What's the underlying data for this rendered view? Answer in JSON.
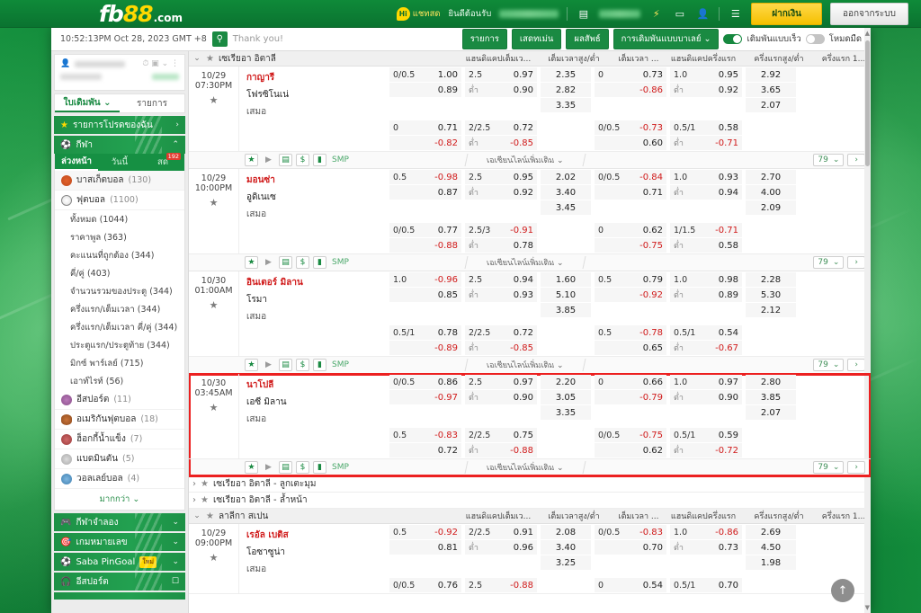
{
  "brand": {
    "fb": "fb",
    "n88": "88",
    "com": ".com"
  },
  "topbar": {
    "hi_badge": "Hi",
    "live_chat": "แชทสด",
    "welcome": "ยินดีต้อนรับ",
    "icons": [
      "wallet-icon",
      "lightning-icon",
      "cash-icon",
      "user-icon",
      "list-icon"
    ],
    "deposit_label": "ฝากเงิน",
    "logout_label": "ออกจากระบบ"
  },
  "toolbar": {
    "clock": "10:52:13PM Oct 28, 2023 GMT +8",
    "search_icon": "search-icon",
    "thank_you": "Thank you!",
    "btn_list": "รายการ",
    "btn_statement": "เสดทเม่น",
    "btn_results": "ผลสัพธ์",
    "parlay_label": "การเดิมพันแบบบาเลย์",
    "quick_bet_label": "เดิมพันแบบเร็ว",
    "dark_mode_label": "โหมดมืด",
    "quick_bet_on": true,
    "dark_mode_on": false
  },
  "sidebar": {
    "bet_tabs": [
      {
        "label": "ใบเดิมพัน",
        "active": true
      },
      {
        "label": "รายการ",
        "active": false
      }
    ],
    "favorites_label": "รายการโปรดของฉัน",
    "sports_label": "กีฬา",
    "sub_tabs": [
      {
        "label": "ล่วงหน้า",
        "active": true,
        "count": ""
      },
      {
        "label": "วันนี้",
        "active": false,
        "count": ""
      },
      {
        "label": "สด",
        "active": false,
        "count": "192"
      }
    ],
    "items": [
      {
        "label": "บาสเก็ตบอล",
        "count": "(130)",
        "icon": "basketball-icon"
      },
      {
        "label": "ฟุตบอล",
        "count": "(1100)",
        "icon": "soccer-icon"
      }
    ],
    "sub_items": [
      {
        "label": "ทั้งหมด",
        "count": "(1044)"
      },
      {
        "label": "ราคาพูล",
        "count": "(363)"
      },
      {
        "label": "คะแนนที่ถูกต้อง",
        "count": "(344)"
      },
      {
        "label": "คี่/คู่",
        "count": "(403)"
      },
      {
        "label": "จำนวนรวมของประตู",
        "count": "(344)"
      },
      {
        "label": "ครึ่งแรก/เต็มเวลา",
        "count": "(344)"
      },
      {
        "label": "ครึ่งแรก/เต็มเวลา คี่/คู่",
        "count": "(344)"
      },
      {
        "label": "ประตูแรก/ประตูท้าย",
        "count": "(344)"
      },
      {
        "label": "มิกซ์ พาร์เลย์",
        "count": "(715)"
      },
      {
        "label": "เอาท์ไรท์",
        "count": "(56)"
      }
    ],
    "items2": [
      {
        "label": "อีสปอร์ต",
        "count": "(11)",
        "icon": "esports-icon"
      },
      {
        "label": "อเมริกันฟุตบอล",
        "count": "(18)",
        "icon": "football-icon"
      },
      {
        "label": "ฮ็อกกี้น้ำแข็ง",
        "count": "(7)",
        "icon": "hockey-icon"
      },
      {
        "label": "แบดมินตัน",
        "count": "(5)",
        "icon": "badminton-icon"
      },
      {
        "label": "วอลเลย์บอล",
        "count": "(4)",
        "icon": "volleyball-icon"
      }
    ],
    "more_label": "มากกว่า",
    "sections": [
      {
        "label": "กีฬาจำลอง",
        "icon": "virtual-sports-icon",
        "badge": "",
        "action": "chevron"
      },
      {
        "label": "เกมหมายเลข",
        "icon": "numbers-game-icon",
        "badge": "",
        "action": "chevron"
      },
      {
        "label": "Saba PinGoal",
        "icon": "pingoal-icon",
        "badge": "ใหม่",
        "action": "chevron"
      },
      {
        "label": "อีสปอร์ต",
        "icon": "esports-icon",
        "badge": "",
        "action": "external"
      }
    ]
  },
  "main": {
    "column_headers": [
      "แฮนดิแคปเต็มเว...",
      "เต็มเวลาสูง/ต่ำ",
      "เต็มเวลา ...",
      "แฮนดิแคปครึ่งแรก",
      "ครึ่งแรกสูง/ต่ำ",
      "ครึ่งแรก 1..."
    ],
    "leagues": [
      {
        "name": "เซเรียอา อิตาลี",
        "expanded": true
      },
      {
        "name": "เซเรียอา อิตาลี - ลูกเตะมุม",
        "expanded": false
      },
      {
        "name": "เซเรียอา อิตาลี - ล้ำหน้า",
        "expanded": false
      },
      {
        "name": "ลาลีกา สเปน",
        "expanded": true
      }
    ],
    "draw_label": "เสมอ",
    "over_under_label": "ต่ำ",
    "more_lines_label": "เอเชียนไลน์เพิ่มเติม",
    "page_select": "79",
    "next_label": "›",
    "smp_label": "SMP",
    "action_icons": [
      "star-icon",
      "play-icon",
      "stats-icon",
      "dollar-icon",
      "chart-icon"
    ],
    "matches": [
      {
        "date": "10/29",
        "time": "07:30PM",
        "home": "กาญารี",
        "away": "โฟรซิโนเน่",
        "ft_hdp": {
          "line1": "0/0.5",
          "odd1": "1.00",
          "line2": "",
          "odd2": "0.89"
        },
        "ft_ou": {
          "line1": "2.5",
          "odd1": "0.97",
          "line2": "ต่ำ",
          "odd2": "0.90"
        },
        "ft_1x2": {
          "home": "2.35",
          "away": "2.82",
          "draw": "3.35"
        },
        "hh_hdp": {
          "line1": "0",
          "odd1": "0.73",
          "line2": "",
          "odd2": "-0.86"
        },
        "hh_ou": {
          "line1": "1.0",
          "odd1": "0.95",
          "line2": "ต่ำ",
          "odd2": "0.92"
        },
        "hh_1x2": {
          "home": "2.92",
          "away": "3.65",
          "draw": "2.07"
        },
        "ft_hdp2": {
          "line1": "0",
          "odd1": "0.71",
          "line2": "",
          "odd2": "-0.82"
        },
        "ft_ou2": {
          "line1": "2/2.5",
          "odd1": "0.72",
          "line2": "ต่ำ",
          "odd2": "-0.85"
        },
        "hh_hdp2": {
          "line1": "0/0.5",
          "odd1": "-0.73",
          "line2": "",
          "odd2": "0.60"
        },
        "hh_ou2": {
          "line1": "0.5/1",
          "odd1": "0.58",
          "line2": "ต่ำ",
          "odd2": "-0.71"
        },
        "highlighted": false
      },
      {
        "date": "10/29",
        "time": "10:00PM",
        "home": "มอนซ่า",
        "away": "อูดิเนเซ",
        "ft_hdp": {
          "line1": "0.5",
          "odd1": "-0.98",
          "line2": "",
          "odd2": "0.87"
        },
        "ft_ou": {
          "line1": "2.5",
          "odd1": "0.95",
          "line2": "ต่ำ",
          "odd2": "0.92"
        },
        "ft_1x2": {
          "home": "2.02",
          "away": "3.40",
          "draw": "3.45"
        },
        "hh_hdp": {
          "line1": "0/0.5",
          "odd1": "-0.84",
          "line2": "",
          "odd2": "0.71"
        },
        "hh_ou": {
          "line1": "1.0",
          "odd1": "0.93",
          "line2": "ต่ำ",
          "odd2": "0.94"
        },
        "hh_1x2": {
          "home": "2.70",
          "away": "4.00",
          "draw": "2.09"
        },
        "ft_hdp2": {
          "line1": "0/0.5",
          "odd1": "0.77",
          "line2": "",
          "odd2": "-0.88"
        },
        "ft_ou2": {
          "line1": "2.5/3",
          "odd1": "-0.91",
          "line2": "ต่ำ",
          "odd2": "0.78"
        },
        "hh_hdp2": {
          "line1": "0",
          "odd1": "0.62",
          "line2": "",
          "odd2": "-0.75"
        },
        "hh_ou2": {
          "line1": "1/1.5",
          "odd1": "-0.71",
          "line2": "ต่ำ",
          "odd2": "0.58"
        },
        "highlighted": false
      },
      {
        "date": "10/30",
        "time": "01:00AM",
        "home": "อินเตอร์ มิลาน",
        "away": "โรมา",
        "ft_hdp": {
          "line1": "1.0",
          "odd1": "-0.96",
          "line2": "",
          "odd2": "0.85"
        },
        "ft_ou": {
          "line1": "2.5",
          "odd1": "0.94",
          "line2": "ต่ำ",
          "odd2": "0.93"
        },
        "ft_1x2": {
          "home": "1.60",
          "away": "5.10",
          "draw": "3.85"
        },
        "hh_hdp": {
          "line1": "0.5",
          "odd1": "0.79",
          "line2": "",
          "odd2": "-0.92"
        },
        "hh_ou": {
          "line1": "1.0",
          "odd1": "0.98",
          "line2": "ต่ำ",
          "odd2": "0.89"
        },
        "hh_1x2": {
          "home": "2.28",
          "away": "5.30",
          "draw": "2.12"
        },
        "ft_hdp2": {
          "line1": "0.5/1",
          "odd1": "0.78",
          "line2": "",
          "odd2": "-0.89"
        },
        "ft_ou2": {
          "line1": "2/2.5",
          "odd1": "0.72",
          "line2": "ต่ำ",
          "odd2": "-0.85"
        },
        "hh_hdp2": {
          "line1": "0.5",
          "odd1": "-0.78",
          "line2": "",
          "odd2": "0.65"
        },
        "hh_ou2": {
          "line1": "0.5/1",
          "odd1": "0.54",
          "line2": "ต่ำ",
          "odd2": "-0.67"
        },
        "highlighted": false
      },
      {
        "date": "10/30",
        "time": "03:45AM",
        "home": "นาโปลี",
        "away": "เอซี มิลาน",
        "ft_hdp": {
          "line1": "0/0.5",
          "odd1": "0.86",
          "line2": "",
          "odd2": "-0.97"
        },
        "ft_ou": {
          "line1": "2.5",
          "odd1": "0.97",
          "line2": "ต่ำ",
          "odd2": "0.90"
        },
        "ft_1x2": {
          "home": "2.20",
          "away": "3.05",
          "draw": "3.35"
        },
        "hh_hdp": {
          "line1": "0",
          "odd1": "0.66",
          "line2": "",
          "odd2": "-0.79"
        },
        "hh_ou": {
          "line1": "1.0",
          "odd1": "0.97",
          "line2": "ต่ำ",
          "odd2": "0.90"
        },
        "hh_1x2": {
          "home": "2.80",
          "away": "3.85",
          "draw": "2.07"
        },
        "ft_hdp2": {
          "line1": "0.5",
          "odd1": "-0.83",
          "line2": "",
          "odd2": "0.72"
        },
        "ft_ou2": {
          "line1": "2/2.5",
          "odd1": "0.75",
          "line2": "ต่ำ",
          "odd2": "-0.88"
        },
        "hh_hdp2": {
          "line1": "0/0.5",
          "odd1": "-0.75",
          "line2": "",
          "odd2": "0.62"
        },
        "hh_ou2": {
          "line1": "0.5/1",
          "odd1": "0.59",
          "line2": "ต่ำ",
          "odd2": "-0.72"
        },
        "highlighted": true
      },
      {
        "date": "10/29",
        "time": "09:00PM",
        "home": "เรอัล เบติส",
        "away": "โอซาซูน่า",
        "ft_hdp": {
          "line1": "0.5",
          "odd1": "-0.92",
          "line2": "",
          "odd2": "0.81"
        },
        "ft_ou": {
          "line1": "2/2.5",
          "odd1": "0.91",
          "line2": "ต่ำ",
          "odd2": "0.96"
        },
        "ft_1x2": {
          "home": "2.08",
          "away": "3.40",
          "draw": "3.25"
        },
        "hh_hdp": {
          "line1": "0/0.5",
          "odd1": "-0.83",
          "line2": "",
          "odd2": "0.70"
        },
        "hh_ou": {
          "line1": "1.0",
          "odd1": "-0.86",
          "line2": "ต่ำ",
          "odd2": "0.73"
        },
        "hh_1x2": {
          "home": "2.69",
          "away": "4.50",
          "draw": "1.98"
        },
        "ft_hdp2": {
          "line1": "0/0.5",
          "odd1": "0.76",
          "line2": "",
          "odd2": ""
        },
        "ft_ou2": {
          "line1": "2.5",
          "odd1": "-0.88",
          "line2": "ต่ำ",
          "odd2": ""
        },
        "hh_hdp2": {
          "line1": "0",
          "odd1": "0.54",
          "line2": "",
          "odd2": ""
        },
        "hh_ou2": {
          "line1": "0.5/1",
          "odd1": "0.70",
          "line2": "ต่ำ",
          "odd2": ""
        },
        "highlighted": false
      }
    ],
    "scroll_top_icon": "scroll-to-top-icon"
  }
}
